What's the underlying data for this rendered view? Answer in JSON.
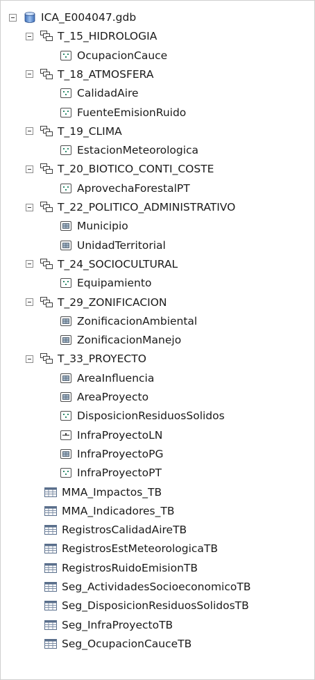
{
  "catalog": {
    "root": {
      "label": "ICA_E004047.gdb",
      "icon": "geodatabase-icon"
    },
    "datasets": [
      {
        "label": "T_15_HIDROLOGIA",
        "children": [
          {
            "label": "OcupacionCauce",
            "icon": "point-feature-class-icon"
          }
        ]
      },
      {
        "label": "T_18_ATMOSFERA",
        "children": [
          {
            "label": "CalidadAire",
            "icon": "point-feature-class-icon"
          },
          {
            "label": "FuenteEmisionRuido",
            "icon": "point-feature-class-icon"
          }
        ]
      },
      {
        "label": "T_19_CLIMA",
        "children": [
          {
            "label": "EstacionMeteorologica",
            "icon": "point-feature-class-icon"
          }
        ]
      },
      {
        "label": "T_20_BIOTICO_CONTI_COSTE",
        "children": [
          {
            "label": "AprovechaForestalPT",
            "icon": "point-feature-class-icon"
          }
        ]
      },
      {
        "label": "T_22_POLITICO_ADMINISTRATIVO",
        "children": [
          {
            "label": "Municipio",
            "icon": "polygon-feature-class-icon"
          },
          {
            "label": "UnidadTerritorial",
            "icon": "polygon-feature-class-icon"
          }
        ]
      },
      {
        "label": "T_24_SOCIOCULTURAL",
        "children": [
          {
            "label": "Equipamiento",
            "icon": "point-feature-class-icon"
          }
        ]
      },
      {
        "label": "T_29_ZONIFICACION",
        "children": [
          {
            "label": "ZonificacionAmbiental",
            "icon": "polygon-feature-class-icon"
          },
          {
            "label": "ZonificacionManejo",
            "icon": "polygon-feature-class-icon"
          }
        ]
      },
      {
        "label": "T_33_PROYECTO",
        "children": [
          {
            "label": "AreaInfluencia",
            "icon": "polygon-feature-class-icon"
          },
          {
            "label": "AreaProyecto",
            "icon": "polygon-feature-class-icon"
          },
          {
            "label": "DisposicionResiduosSolidos",
            "icon": "point-feature-class-icon"
          },
          {
            "label": "InfraProyectoLN",
            "icon": "line-feature-class-icon"
          },
          {
            "label": "InfraProyectoPG",
            "icon": "polygon-feature-class-icon"
          },
          {
            "label": "InfraProyectoPT",
            "icon": "point-feature-class-icon"
          }
        ]
      }
    ],
    "tables": [
      {
        "label": "MMA_Impactos_TB",
        "icon": "table-icon"
      },
      {
        "label": "MMA_Indicadores_TB",
        "icon": "table-icon"
      },
      {
        "label": "RegistrosCalidadAireTB",
        "icon": "table-icon"
      },
      {
        "label": "RegistrosEstMeteorologicaTB",
        "icon": "table-icon"
      },
      {
        "label": "RegistrosRuidoEmisionTB",
        "icon": "table-icon"
      },
      {
        "label": "Seg_ActividadesSocioeconomicoTB",
        "icon": "table-icon"
      },
      {
        "label": "Seg_DisposicionResiduosSolidosTB",
        "icon": "table-icon"
      },
      {
        "label": "Seg_InfraProyectoTB",
        "icon": "table-icon"
      },
      {
        "label": "Seg_OcupacionCauceTB",
        "icon": "table-icon"
      }
    ]
  }
}
